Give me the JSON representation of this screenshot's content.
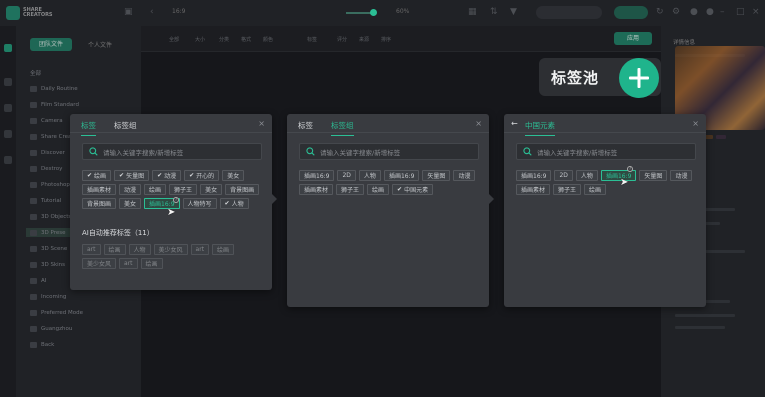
{
  "app": {
    "logo_text": "SHARE CREATORS",
    "ratio": "16:9",
    "zoom": "60%"
  },
  "sidebar": {
    "tabs": [
      "团队文件",
      "个人文件"
    ],
    "section": "全部",
    "items": [
      "Daily Routine",
      "Film Standard",
      "Camera",
      "Share Creators",
      "Discover",
      "Destroy",
      "Photoshop",
      "Tutorial",
      "3D Objects",
      "3D Prese",
      "3D Scene",
      "3D Skins",
      "AI",
      "Incoming",
      "Preferred Mode",
      "Guangzhou",
      "Back"
    ]
  },
  "canvas_toolbar": {
    "items": [
      "全部",
      "大小",
      "分类",
      "格式",
      "颜色",
      "标签",
      "评分",
      "来源",
      "排序"
    ],
    "button": "应用"
  },
  "right_panel": {
    "title": "详情信息"
  },
  "callout": {
    "label": "标签池"
  },
  "panel1": {
    "tabs": [
      "标签",
      "标签组"
    ],
    "search_placeholder": "请输入关键字搜索/新增标签",
    "tags": [
      {
        "label": "绘画",
        "state": "checked"
      },
      {
        "label": "矢量图",
        "state": "checked"
      },
      {
        "label": "动漫",
        "state": "checked"
      },
      {
        "label": "开心的",
        "state": "checked"
      },
      {
        "label": "美女",
        "state": "normal"
      },
      {
        "label": "插画素材",
        "state": "normal"
      },
      {
        "label": "动漫",
        "state": "normal"
      },
      {
        "label": "绘画",
        "state": "normal"
      },
      {
        "label": "狮子王",
        "state": "normal"
      },
      {
        "label": "美女",
        "state": "normal"
      },
      {
        "label": "背景图画",
        "state": "normal"
      },
      {
        "label": "背景图画",
        "state": "normal"
      },
      {
        "label": "美女",
        "state": "normal"
      },
      {
        "label": "插画16:9",
        "state": "selected"
      },
      {
        "label": "人物特写",
        "state": "normal"
      },
      {
        "label": "人物",
        "state": "checked"
      }
    ],
    "ai_title": "AI自动推荐标签（11）",
    "ai_tags": [
      "art",
      "绘画",
      "人物",
      "美少女风",
      "art",
      "绘画",
      "美少女风",
      "art",
      "绘画"
    ]
  },
  "panel2": {
    "tabs": [
      "标签",
      "标签组"
    ],
    "search_placeholder": "请输入关键字搜索/新增标签",
    "tags": [
      {
        "label": "插画16:9",
        "state": "normal"
      },
      {
        "label": "2D",
        "state": "normal"
      },
      {
        "label": "人物",
        "state": "normal"
      },
      {
        "label": "插画16:9",
        "state": "normal"
      },
      {
        "label": "矢量图",
        "state": "normal"
      },
      {
        "label": "动漫",
        "state": "normal"
      },
      {
        "label": "插画素材",
        "state": "normal"
      },
      {
        "label": "狮子王",
        "state": "normal"
      },
      {
        "label": "绘画",
        "state": "normal"
      },
      {
        "label": "中国元素",
        "state": "checked"
      }
    ]
  },
  "panel3": {
    "title": "中国元素",
    "search_placeholder": "请输入关键字搜索/新增标签",
    "tags": [
      {
        "label": "插画16:9",
        "state": "normal"
      },
      {
        "label": "2D",
        "state": "normal"
      },
      {
        "label": "人物",
        "state": "normal"
      },
      {
        "label": "插画16:9",
        "state": "selected"
      },
      {
        "label": "矢量图",
        "state": "normal"
      },
      {
        "label": "动漫",
        "state": "normal"
      },
      {
        "label": "插画素材",
        "state": "normal"
      },
      {
        "label": "狮子王",
        "state": "normal"
      },
      {
        "label": "绘画",
        "state": "normal"
      }
    ]
  },
  "colors": {
    "accent": "#2bbf95",
    "panel": "#393b40",
    "background": "#1b1c20"
  }
}
